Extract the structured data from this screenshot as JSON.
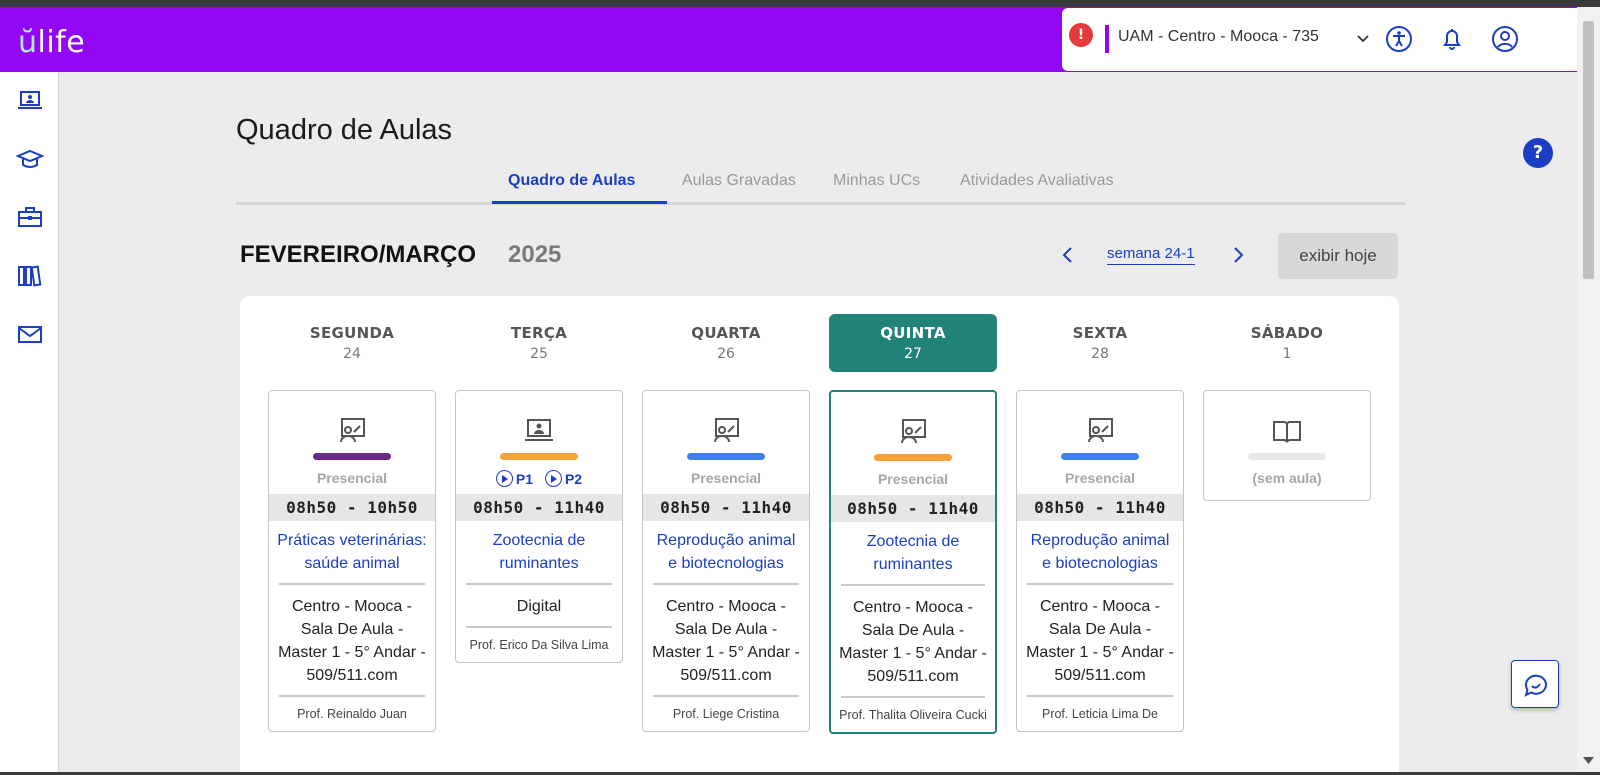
{
  "brand": {
    "logo_u": "ŭ",
    "logo_rest": "life"
  },
  "topbar": {
    "info_icon": "!",
    "unit_label": "UAM - Centro - Mooca - 735",
    "icons": [
      "accessibility-icon",
      "bell-icon",
      "user-circle-icon"
    ]
  },
  "sidebar": {
    "items": [
      "laptop-icon",
      "graduation-cap-icon",
      "briefcase-icon",
      "books-icon",
      "mail-icon"
    ]
  },
  "page": {
    "title": "Quadro de Aulas"
  },
  "tabs": [
    {
      "label": "Quadro de Aulas",
      "active": true
    },
    {
      "label": "Aulas Gravadas",
      "active": false
    },
    {
      "label": "Minhas UCs",
      "active": false
    },
    {
      "label": "Atividades Avaliativas",
      "active": false
    }
  ],
  "period": {
    "month": "FEVEREIRO/MARÇO",
    "year": "2025",
    "week": "semana 24-1",
    "today_button": "exibir hoje"
  },
  "days": [
    {
      "name": "SEGUNDA",
      "date": "24",
      "today": false
    },
    {
      "name": "TERÇA",
      "date": "25",
      "today": false
    },
    {
      "name": "QUARTA",
      "date": "26",
      "today": false
    },
    {
      "name": "QUINTA",
      "date": "27",
      "today": true
    },
    {
      "name": "SEXTA",
      "date": "28",
      "today": false
    },
    {
      "name": "SÁBADO",
      "date": "1",
      "today": false
    }
  ],
  "classes": [
    {
      "mode": "Presencial",
      "color": "#6a2a8c",
      "time": "08h50 - 10h50",
      "subject": "Práticas veterinárias: saúde animal",
      "room": "Centro - Mooca - Sala De Aula - Master 1 - 5° Andar - 509/511.com",
      "prof": "Prof. Reinaldo Juan"
    },
    {
      "mode": "",
      "color": "#f5a23a",
      "time": "08h50 - 11h40",
      "subject": "Zootecnia de ruminantes",
      "room": "Digital",
      "prof": "Prof. Erico Da Silva Lima",
      "badges": [
        "P1",
        "P2"
      ]
    },
    {
      "mode": "Presencial",
      "color": "#3b82f0",
      "time": "08h50 - 11h40",
      "subject": "Reprodução animal e biotecnologias",
      "room": "Centro - Mooca - Sala De Aula - Master 1 - 5° Andar - 509/511.com",
      "prof": "Prof. Liege Cristina"
    },
    {
      "mode": "Presencial",
      "color": "#f5a23a",
      "time": "08h50 - 11h40",
      "subject": "Zootecnia de ruminantes",
      "room": "Centro - Mooca - Sala De Aula - Master 1 - 5° Andar - 509/511.com",
      "prof": "Prof. Thalita Oliveira Cucki"
    },
    {
      "mode": "Presencial",
      "color": "#3b82f0",
      "time": "08h50 - 11h40",
      "subject": "Reprodução animal e biotecnologias",
      "room": "Centro - Mooca - Sala De Aula - Master 1 - 5° Andar - 509/511.com",
      "prof": "Prof. Leticia Lima De"
    },
    {
      "mode": "(sem aula)",
      "color": "#e8e8e8"
    }
  ],
  "help": {
    "label": "?"
  },
  "colors": {
    "brand_purple": "#9306f4",
    "today_teal": "#218278",
    "link_blue": "#1c3ec4"
  }
}
